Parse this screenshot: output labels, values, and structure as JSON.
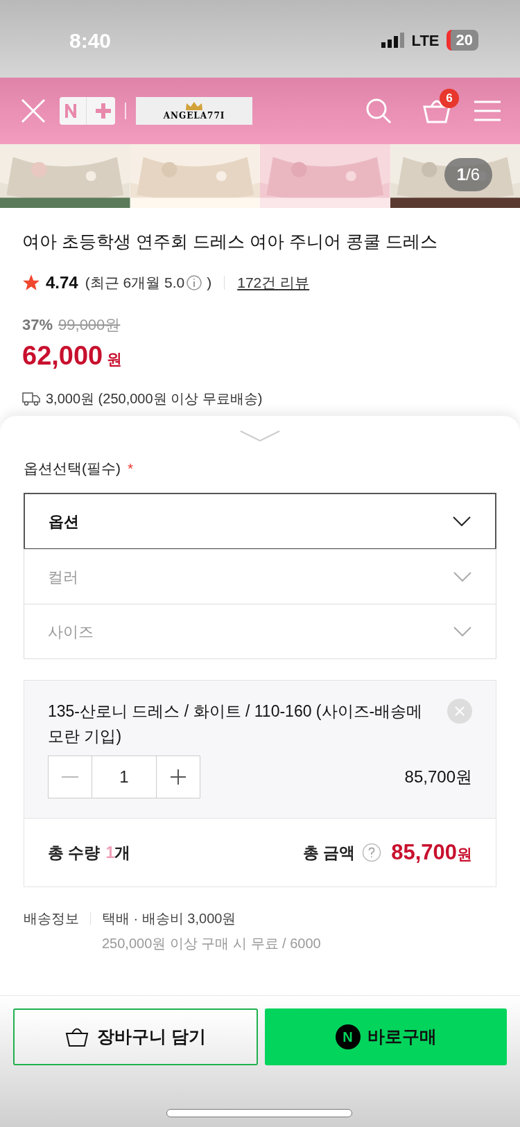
{
  "status_bar": {
    "time": "8:40",
    "network": "LTE",
    "battery": "20"
  },
  "header": {
    "logo": "ANGELA77I",
    "cart_count": "6"
  },
  "gallery": {
    "counter_current": "1",
    "counter_total": "/6"
  },
  "product": {
    "title": "여아 초등학생 연주회 드레스 여아 주니어 콩쿨 드레스",
    "rating": "4.74",
    "recent": "(최근 6개월 5.0",
    "recent_close": ")",
    "reviews": "172건 리뷰",
    "discount": "37%",
    "original_price": "99,000원",
    "price": "62,000",
    "price_unit": "원",
    "shipping": "3,000원 (250,000원 이상 무료배송)"
  },
  "options": {
    "label": "옵션선택(필수)",
    "required_mark": "*",
    "selects": [
      {
        "label": "옵션",
        "active": true
      },
      {
        "label": "컬러",
        "active": false
      },
      {
        "label": "사이즈",
        "active": false
      }
    ]
  },
  "selected_item": {
    "name": "135-산로니 드레스 / 화이트 / 110-160 (사이즈-배송메모란 기입)",
    "quantity": "1",
    "price": "85,700원"
  },
  "summary": {
    "quantity_label": "총 수량",
    "quantity": "1",
    "quantity_unit": "개",
    "amount_label": "총 금액",
    "amount": "85,700",
    "amount_unit": "원"
  },
  "delivery": {
    "label": "배송정보",
    "line1": "택배 · 배송비 3,000원",
    "line2": "250,000원 이상 구매 시 무료 / 6000"
  },
  "buttons": {
    "cart": "장바구니 담기",
    "buy_badge": "N",
    "buy": "바로구매"
  }
}
